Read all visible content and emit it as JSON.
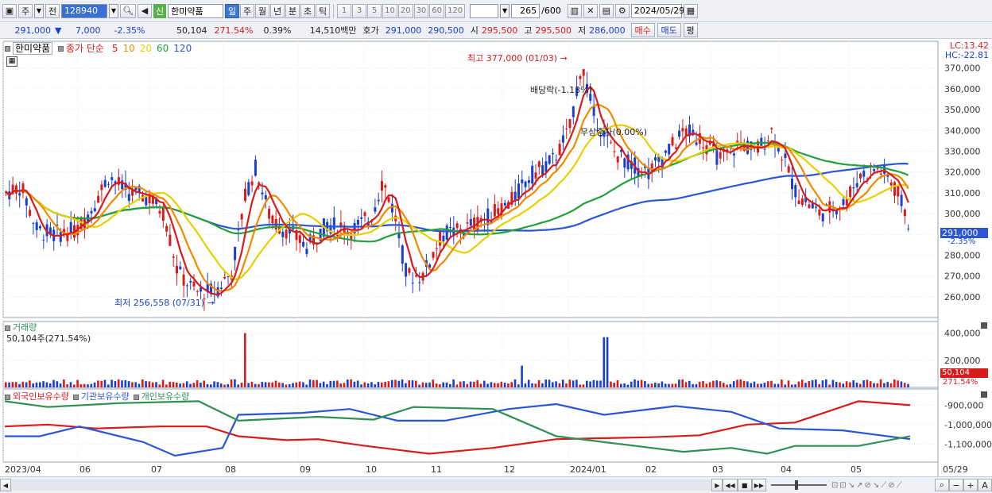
{
  "toolbar": {
    "period_label": "주",
    "prev_label": "전",
    "code": "128940",
    "sin_tag": "신",
    "stock_name": "한미약품",
    "tabs": [
      "일",
      "주",
      "월",
      "년",
      "분",
      "초",
      "틱"
    ],
    "nums": [
      "1",
      "3",
      "5",
      "10",
      "20",
      "30",
      "60",
      "120"
    ],
    "count": "265",
    "count_total": "/600",
    "date": "2024/05/29"
  },
  "quote": {
    "price": "291,000",
    "change_arrow": "▼",
    "change": "7,000",
    "change_pct": "-2.35%",
    "volume": "50,104",
    "vol_ratio": "271.54%",
    "turnover": "0.39%",
    "amount": "14,510백만",
    "hoga_label": "호가",
    "bid": "291,000",
    "ask": "290,500",
    "open_label": "시",
    "open": "295,500",
    "high_label": "고",
    "high": "295,500",
    "low_label": "저",
    "low": "286,000",
    "buy_label": "매수",
    "sell_label": "매도",
    "eval_label": "평"
  },
  "price_panel": {
    "name": "한미약품",
    "ma_prefix": "종가 단순",
    "mas": [
      {
        "p": "5",
        "c": "#d81b1b"
      },
      {
        "p": "10",
        "c": "#f08a00"
      },
      {
        "p": "20",
        "c": "#e8d000"
      },
      {
        "p": "60",
        "c": "#22a03a"
      },
      {
        "p": "120",
        "c": "#2b55d6"
      }
    ],
    "lc": "LC:13.42",
    "hc": "HC:-22.81",
    "max_label": "최고 377,000 (01/03)",
    "min_label": "최저 256,558 (07/31)",
    "div_label": "배당락(-1.13%)",
    "bonus_label": "무상증자(0.00%)",
    "yticks": [
      "370,000",
      "360,000",
      "350,000",
      "340,000",
      "330,000",
      "320,000",
      "310,000",
      "300,000",
      "290,000",
      "280,000",
      "270,000",
      "260,000"
    ],
    "cur_price": "291,000",
    "cur_pct": "-2.35%"
  },
  "volume_panel": {
    "title": "거래량",
    "value": "50,104주(271.54%)",
    "yticks": [
      "400,000",
      "200,000"
    ],
    "cur": "50,104",
    "cur_pct": "271.54%"
  },
  "holder_panel": {
    "labels": [
      {
        "t": "외국인보유수량",
        "c": "#d81b1b"
      },
      {
        "t": "기관보유수량",
        "c": "#2b55d6"
      },
      {
        "t": "개인보유수량",
        "c": "#2f8f55"
      }
    ],
    "yticks": [
      "-900,000",
      "-1,000,000",
      "-1,100,000"
    ]
  },
  "xaxis": {
    "labels": [
      "2023/04",
      "06",
      "07",
      "08",
      "09",
      "10",
      "11",
      "12",
      "2024/01",
      "02",
      "03",
      "04",
      "05"
    ],
    "end": "05/29"
  },
  "colors": {
    "up": "#d81b1b",
    "down": "#1a3fd0",
    "ma5": "#d81b1b",
    "ma10": "#f08a00",
    "ma20": "#e8d000",
    "ma60": "#22a03a",
    "ma120": "#2b55d6"
  }
}
